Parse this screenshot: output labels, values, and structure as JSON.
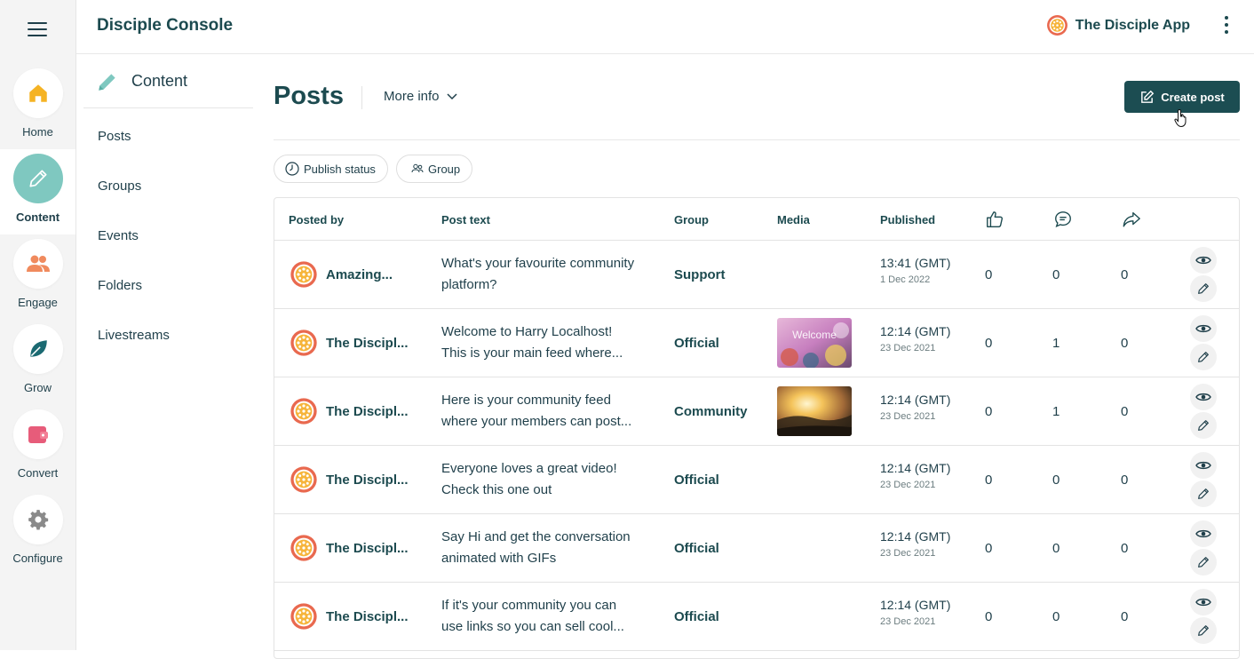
{
  "rail": {
    "items": [
      {
        "label": "Home",
        "icon": "home-icon",
        "active": false
      },
      {
        "label": "Content",
        "icon": "pencil-icon",
        "active": true
      },
      {
        "label": "Engage",
        "icon": "people-icon",
        "active": false
      },
      {
        "label": "Grow",
        "icon": "leaf-icon",
        "active": false
      },
      {
        "label": "Convert",
        "icon": "wallet-icon",
        "active": false
      },
      {
        "label": "Configure",
        "icon": "gear-icon",
        "active": false
      }
    ]
  },
  "topbar": {
    "console_title": "Disciple Console",
    "app_name": "The Disciple App"
  },
  "subnav": {
    "header": "Content",
    "items": [
      "Posts",
      "Groups",
      "Events",
      "Folders",
      "Livestreams"
    ]
  },
  "main": {
    "title": "Posts",
    "more_info": "More info",
    "create_post": "Create post",
    "filters": {
      "publish_status": "Publish status",
      "group": "Group"
    }
  },
  "table": {
    "headers": {
      "posted_by": "Posted by",
      "post_text": "Post text",
      "group": "Group",
      "media": "Media",
      "published": "Published"
    },
    "header_icons": [
      "like-icon",
      "comment-icon",
      "share-icon"
    ],
    "rows": [
      {
        "posted_by": "Amazing...",
        "text1": "What's your favourite community",
        "text2": "platform?",
        "group": "Support",
        "media": null,
        "time": "13:41 (GMT)",
        "date": "1 Dec 2022",
        "likes": "0",
        "comments": "0",
        "shares": "0"
      },
      {
        "posted_by": "The Discipl...",
        "text1": "Welcome to Harry Localhost!",
        "text2": "This is your main feed where...",
        "group": "Official",
        "media": "welcome",
        "time": "12:14 (GMT)",
        "date": "23 Dec 2021",
        "likes": "0",
        "comments": "1",
        "shares": "0"
      },
      {
        "posted_by": "The Discipl...",
        "text1": "Here is your community feed",
        "text2": "where your members can post...",
        "group": "Community",
        "media": "sunset",
        "time": "12:14 (GMT)",
        "date": "23 Dec 2021",
        "likes": "0",
        "comments": "1",
        "shares": "0"
      },
      {
        "posted_by": "The Discipl...",
        "text1": "Everyone loves a great video!",
        "text2": "Check this one out",
        "group": "Official",
        "media": null,
        "time": "12:14 (GMT)",
        "date": "23 Dec 2021",
        "likes": "0",
        "comments": "0",
        "shares": "0"
      },
      {
        "posted_by": "The Discipl...",
        "text1": "Say Hi and get the conversation",
        "text2": "animated with GIFs",
        "group": "Official",
        "media": null,
        "time": "12:14 (GMT)",
        "date": "23 Dec 2021",
        "likes": "0",
        "comments": "0",
        "shares": "0"
      },
      {
        "posted_by": "The Discipl...",
        "text1": "If it's your community you can",
        "text2": "use links so you can sell cool...",
        "group": "Official",
        "media": null,
        "time": "12:14 (GMT)",
        "date": "23 Dec 2021",
        "likes": "0",
        "comments": "0",
        "shares": "0"
      }
    ]
  },
  "media_text": {
    "welcome": "Welcome"
  },
  "colors": {
    "brand": "#1c4d52",
    "active_circle": "#7fc8c0",
    "rail_bg": "#f4f4f4"
  }
}
